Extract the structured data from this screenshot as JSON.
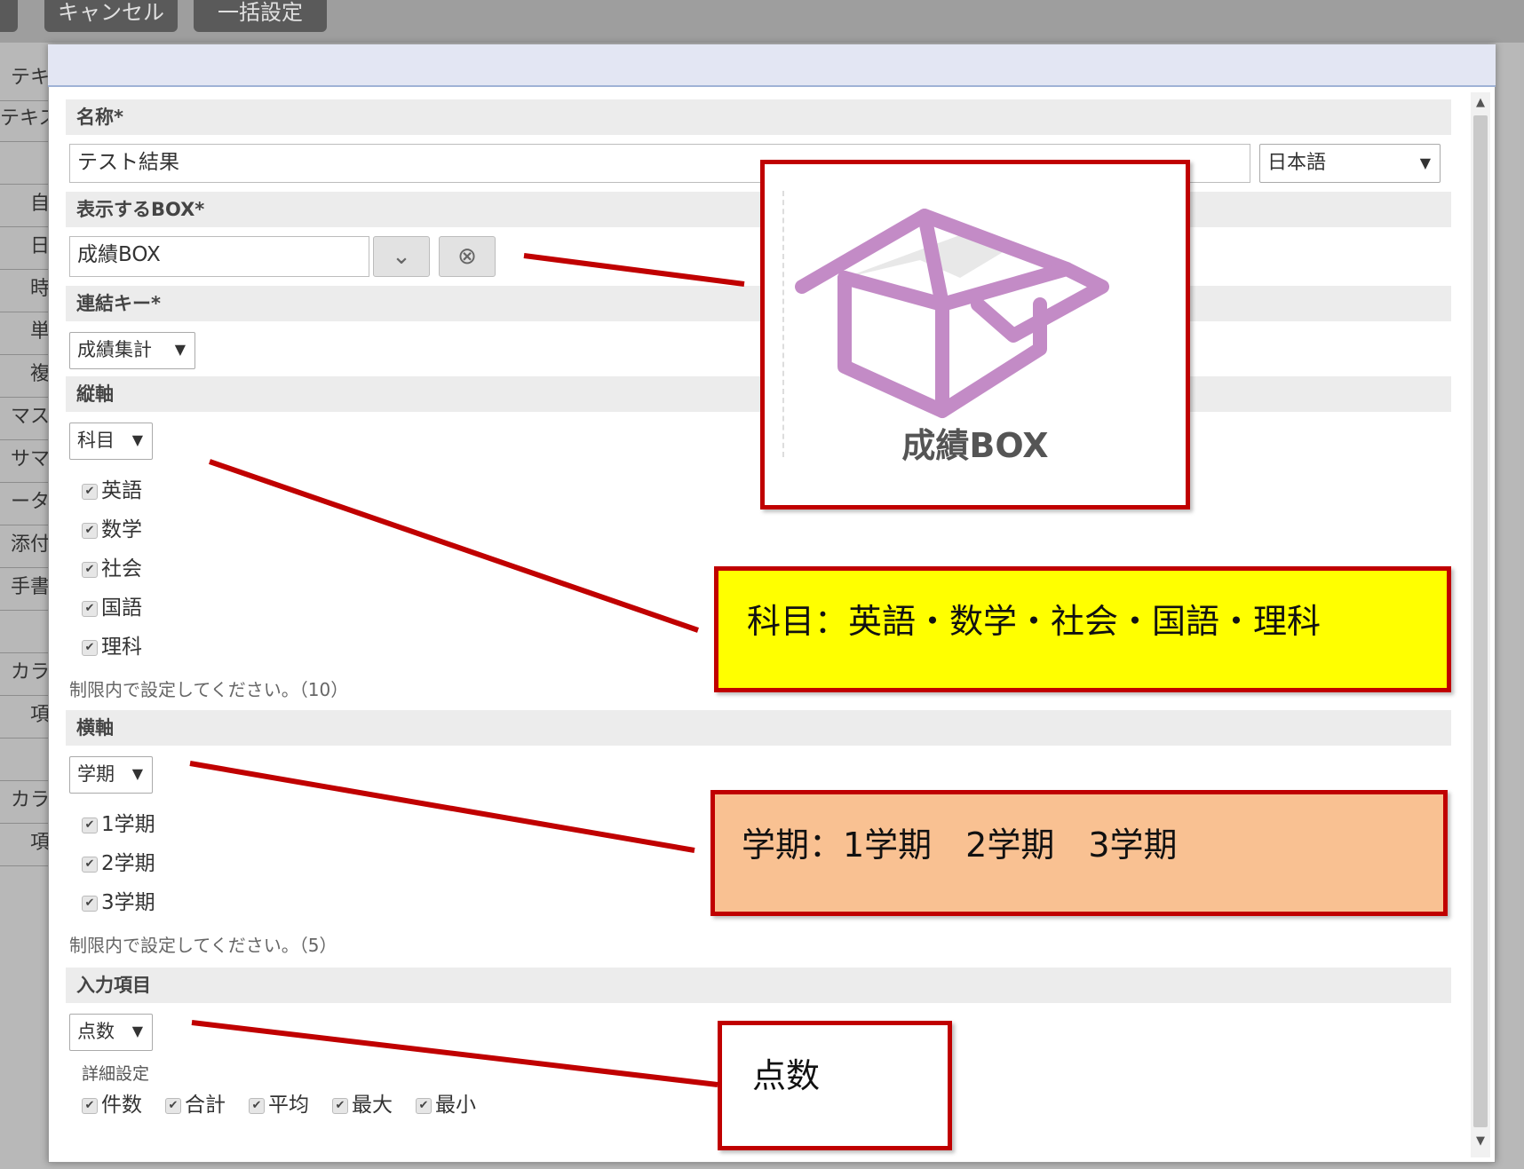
{
  "background": {
    "top_buttons": [
      "キャンセル",
      "一括設定"
    ],
    "sidebar_items": [
      "テキ",
      "テキス",
      "",
      "自",
      "日",
      "時",
      "単",
      "複",
      "マス",
      "サマ",
      "ータ",
      "添付",
      "手書",
      "",
      "カラ",
      "項",
      "",
      "カラ",
      "項"
    ]
  },
  "dialog": {
    "name_section": {
      "label": "名称*",
      "value": "テスト結果",
      "language": "日本語"
    },
    "box_section": {
      "label": "表示するBOX*",
      "value": "成績BOX"
    },
    "key_section": {
      "label": "連結キー*",
      "value": "成績集計"
    },
    "vertical_section": {
      "label": "縦軸",
      "value": "科目",
      "items": [
        "英語",
        "数学",
        "社会",
        "国語",
        "理科"
      ],
      "note": "制限内で設定してください。（10）"
    },
    "horizontal_section": {
      "label": "横軸",
      "value": "学期",
      "items": [
        "1学期",
        "2学期",
        "3学期"
      ],
      "note": "制限内で設定してください。（5）"
    },
    "input_section": {
      "label": "入力項目",
      "value": "点数",
      "detail_label": "詳細設定",
      "options": [
        "件数",
        "合計",
        "平均",
        "最大",
        "最小"
      ]
    }
  },
  "annotations": {
    "box_caption": "成績BOX",
    "subjects": "科目：英語・数学・社会・国語・理科",
    "terms": "学期：1学期　2学期　3学期",
    "input": "点数"
  },
  "colors": {
    "callout_border": "#c00000",
    "box_icon": "#c38bc6",
    "subjects_bg": "#ffff00",
    "terms_bg": "#f9c192",
    "header_bg": "#e3e6f3"
  },
  "icons": {
    "dropdown": "▼",
    "checkbox": "✔",
    "clear": "⊗",
    "chevron": "⌄",
    "scroll_up": "▲",
    "scroll_down": "▼"
  }
}
